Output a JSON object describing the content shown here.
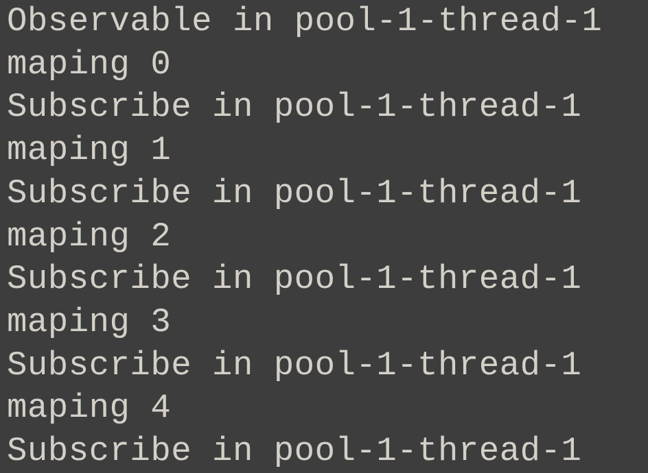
{
  "console": {
    "lines": [
      "Observable in pool-1-thread-1",
      "maping 0",
      "Subscribe in pool-1-thread-1",
      "maping 1",
      "Subscribe in pool-1-thread-1",
      "maping 2",
      "Subscribe in pool-1-thread-1",
      "maping 3",
      "Subscribe in pool-1-thread-1",
      "maping 4",
      "Subscribe in pool-1-thread-1"
    ]
  }
}
